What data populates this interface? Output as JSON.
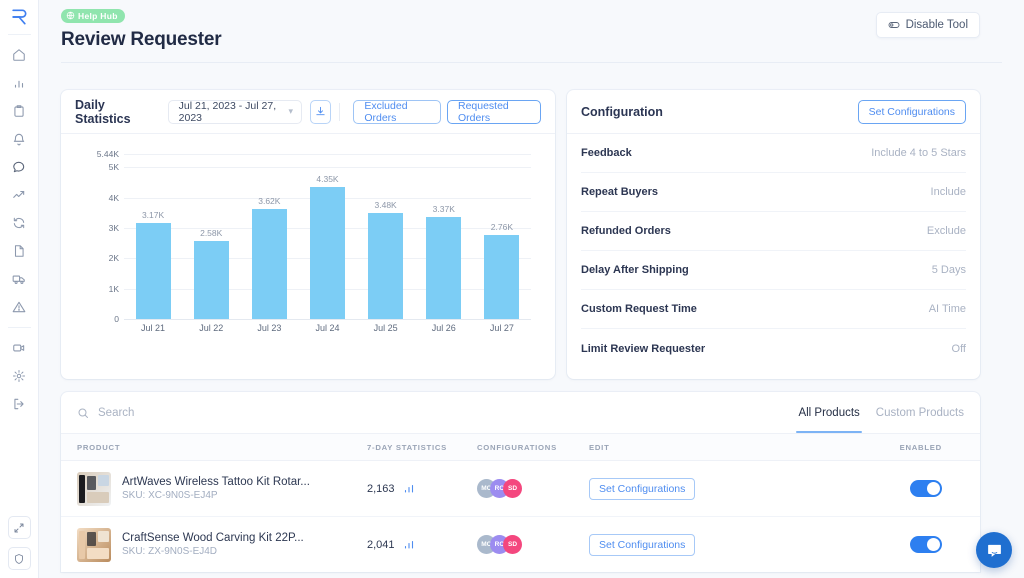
{
  "sidebar": {
    "logo": "logo-r",
    "items": [
      {
        "icon": "home-icon",
        "name": "home"
      },
      {
        "icon": "bar-chart-icon",
        "name": "analytics"
      },
      {
        "icon": "clipboard-icon",
        "name": "orders"
      },
      {
        "icon": "bell-icon",
        "name": "alerts"
      },
      {
        "icon": "chat-icon",
        "name": "messages"
      },
      {
        "icon": "trending-up-icon",
        "name": "trends"
      },
      {
        "icon": "refresh-icon",
        "name": "sync"
      },
      {
        "icon": "document-icon",
        "name": "reports"
      },
      {
        "icon": "truck-icon",
        "name": "shipping"
      },
      {
        "icon": "warning-icon",
        "name": "issues"
      }
    ],
    "items_secondary": [
      {
        "icon": "video-icon",
        "name": "tutorials"
      },
      {
        "icon": "gear-icon",
        "name": "settings"
      },
      {
        "icon": "logout-icon",
        "name": "logout"
      }
    ],
    "bottom": [
      {
        "icon": "expand-icon",
        "name": "expand-sidebar"
      },
      {
        "icon": "shield-icon",
        "name": "security"
      }
    ]
  },
  "header": {
    "badge": "Help Hub",
    "badge_icon": "globe-icon",
    "title": "Review Requester",
    "disable_button": "Disable Tool",
    "disable_icon": "toggle-off-icon"
  },
  "stats_card": {
    "title": "Daily Statistics",
    "date_range": "Jul 21, 2023 - Jul 27, 2023",
    "chevron": "chevron-down-icon",
    "download_icon": "download-icon",
    "excluded_button": "Excluded Orders",
    "requested_button": "Requested Orders"
  },
  "chart_data": {
    "type": "bar",
    "title": "Daily Statistics",
    "categories": [
      "Jul 21",
      "Jul 22",
      "Jul 23",
      "Jul 24",
      "Jul 25",
      "Jul 26",
      "Jul 27"
    ],
    "values": [
      3170,
      2580,
      3620,
      4350,
      3480,
      3370,
      2760
    ],
    "value_labels": [
      "3.17K",
      "2.58K",
      "3.62K",
      "4.35K",
      "3.48K",
      "3.37K",
      "2.76K"
    ],
    "ytick_labels": [
      "5.44K",
      "5K",
      "4K",
      "3K",
      "2K",
      "1K",
      "0"
    ],
    "ytick_values": [
      5440,
      5000,
      4000,
      3000,
      2000,
      1000,
      0
    ],
    "ylim": [
      0,
      5440
    ],
    "xlabel": "",
    "ylabel": "",
    "grid": true,
    "legend": false,
    "bar_color": "#7ccdf5"
  },
  "config_card": {
    "title": "Configuration",
    "set_button": "Set Configurations",
    "rows": [
      {
        "label": "Feedback",
        "value": "Include 4 to 5 Stars"
      },
      {
        "label": "Repeat Buyers",
        "value": "Include"
      },
      {
        "label": "Refunded Orders",
        "value": "Exclude"
      },
      {
        "label": "Delay After Shipping",
        "value": "5 Days"
      },
      {
        "label": "Custom Request Time",
        "value": "AI Time"
      },
      {
        "label": "Limit Review Requester",
        "value": "Off"
      }
    ]
  },
  "products": {
    "search_placeholder": "Search",
    "search_value": "",
    "search_icon": "search-icon",
    "tabs": [
      {
        "label": "All Products",
        "active": true
      },
      {
        "label": "Custom Products",
        "active": false
      }
    ],
    "columns": [
      "PRODUCT",
      "7-DAY STATISTICS",
      "CONFIGURATIONS",
      "EDIT",
      "ENABLED"
    ],
    "rows": [
      {
        "name": "ArtWaves Wireless Tattoo Kit Rotar...",
        "sku": "SKU: XC-9N0S-EJ4P",
        "stat": "2,163",
        "stat_icon": "bar-chart-icon",
        "avatars": [
          {
            "initials": "MO",
            "color": "#aab9cc"
          },
          {
            "initials": "RO",
            "color": "#9c8cf0"
          },
          {
            "initials": "SD",
            "color": "#f4477e"
          }
        ],
        "edit_button": "Set Configurations",
        "enabled": true
      },
      {
        "name": "CraftSense Wood Carving Kit 22P...",
        "sku": "SKU: ZX-9N0S-EJ4D",
        "stat": "2,041",
        "stat_icon": "bar-chart-icon",
        "avatars": [
          {
            "initials": "MO",
            "color": "#aab9cc"
          },
          {
            "initials": "RO",
            "color": "#9c8cf0"
          },
          {
            "initials": "SD",
            "color": "#f4477e"
          }
        ],
        "edit_button": "Set Configurations",
        "enabled": true
      }
    ]
  },
  "chat": {
    "icon": "chat-bubble-icon"
  },
  "colors": {
    "accent_blue": "#4f8df0",
    "bar_blue": "#7ccdf5",
    "badge_green": "#90e5ae",
    "toggle_on": "#2d7ff0",
    "page_bg": "#f7f9fc"
  }
}
